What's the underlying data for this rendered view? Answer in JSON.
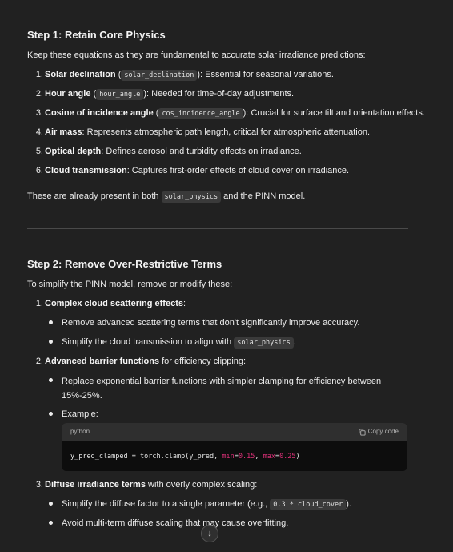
{
  "step1": {
    "title": "Step 1: Retain Core Physics",
    "intro": "Keep these equations as they are fundamental to accurate solar irradiance predictions:",
    "items": [
      {
        "num": "1.",
        "bold": "Solar declination",
        "pre": " (",
        "code": "solar_declination",
        "post": "): Essential for seasonal variations."
      },
      {
        "num": "2.",
        "bold": "Hour angle",
        "pre": " (",
        "code": "hour_angle",
        "post": "): Needed for time-of-day adjustments."
      },
      {
        "num": "3.",
        "bold": "Cosine of incidence angle",
        "pre": " (",
        "code": "cos_incidence_angle",
        "post": "): Crucial for surface tilt and orientation effects."
      },
      {
        "num": "4.",
        "bold": "Air mass",
        "text": ": Represents atmospheric path length, critical for atmospheric attenuation."
      },
      {
        "num": "5.",
        "bold": "Optical depth",
        "text": ": Defines aerosol and turbidity effects on irradiance."
      },
      {
        "num": "6.",
        "bold": "Cloud transmission",
        "text": ": Captures first-order effects of cloud cover on irradiance."
      }
    ],
    "footer_pre": "These are already present in both ",
    "footer_code": "solar_physics",
    "footer_post": " and the PINN model."
  },
  "step2": {
    "title": "Step 2: Remove Over-Restrictive Terms",
    "intro": "To simplify the PINN model, remove or modify these:",
    "item1": {
      "num": "1.",
      "bold": "Complex cloud scattering effects",
      "text": ":",
      "b1": "Remove advanced scattering terms that don't significantly improve accuracy.",
      "b2_pre": "Simplify the cloud transmission to align with ",
      "b2_code": "solar_physics",
      "b2_post": "."
    },
    "item2": {
      "num": "2.",
      "bold": "Advanced barrier functions",
      "text": " for efficiency clipping:",
      "b1": "Replace exponential barrier functions with simpler clamping for efficiency between 15%-25%.",
      "b2": "Example:"
    },
    "code": {
      "lang": "python",
      "copy_label": "Copy code",
      "line_pre": "y_pred_clamped = torch.clamp(y_pred, ",
      "kw1": "min",
      "eq1": "=",
      "n1": "0.15",
      "sep": ", ",
      "kw2": "max",
      "eq2": "=",
      "n2": "0.25",
      "line_post": ")"
    },
    "item3": {
      "num": "3.",
      "bold": "Diffuse irradiance terms",
      "text": " with overly complex scaling:",
      "b1_pre": "Simplify the diffuse factor to a single parameter (e.g., ",
      "b1_code": "0.3 * cloud_cover",
      "b1_post": ").",
      "b2": "Avoid multi-term diffuse scaling that may cause overfitting."
    }
  },
  "scroll_icon": "↓"
}
